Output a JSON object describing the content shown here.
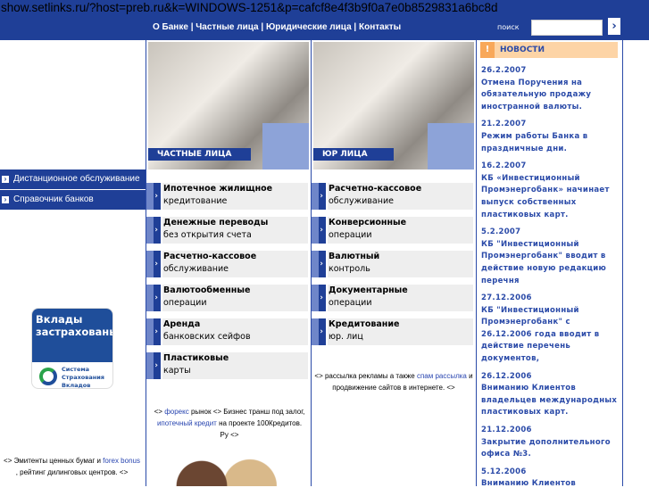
{
  "url": "show.setlinks.ru/?host=preb.ru&k=WINDOWS-1251&p=cafcf8e4f3b9f0a7e0b8529831a6bc8d",
  "nav": [
    "О Банке",
    "Частные лица",
    "Юридические лица",
    "Контакты"
  ],
  "search": {
    "label": "поиск",
    "value": "",
    "button": "›"
  },
  "photos": {
    "private": "ЧАСТНЫЕ ЛИЦА",
    "corporate": "ЮР ЛИЦА"
  },
  "left_menu": [
    "Дистанционное обслуживание",
    "Справочник банков"
  ],
  "badge": {
    "title": "Вклады застрахованы",
    "sub": "Система Страхования Вкладов"
  },
  "private_services": [
    {
      "bold": "Ипотечное жилищное",
      "rest": "кредитование"
    },
    {
      "bold": "Денежные переводы",
      "rest": "без открытия счета"
    },
    {
      "bold": "Расчетно-кассовое",
      "rest": "обслуживание"
    },
    {
      "bold": "Валютообменные",
      "rest": "операции"
    },
    {
      "bold": "Аренда",
      "rest": "банковских сейфов"
    },
    {
      "bold": "Пластиковые",
      "rest": "карты"
    }
  ],
  "corporate_services": [
    {
      "bold": "Расчетно-кассовое",
      "rest": "обслуживание"
    },
    {
      "bold": "Конверсионные",
      "rest": "операции"
    },
    {
      "bold": "Валютный",
      "rest": "контроль"
    },
    {
      "bold": "Документарные",
      "rest": "операции"
    },
    {
      "bold": "Кредитование",
      "rest": "юр. лиц"
    }
  ],
  "ads": {
    "left": {
      "t1": "<> Эмитенты ценных бумаг и ",
      "l1": "forex bonus",
      "t2": " , рейтинг дилинговых центров. <>"
    },
    "center": {
      "t1": "<> ",
      "l1": "форекс",
      "t2": " рынок <> Бизнес транш под залог, ",
      "l2": "ипотечный кредит",
      "t3": " на проекте 100Кредитов. Ру <>"
    },
    "right": {
      "t1": "<> рассылка рекламы а также ",
      "l1": "спам рассылка",
      "t2": " и продвижение сайтов в интернете. <>"
    }
  },
  "news": {
    "title": "НОВОСТИ",
    "items": [
      {
        "date": "26.2.2007",
        "text": "Отмена Поручения на обязательную продажу иностранной валюты."
      },
      {
        "date": "21.2.2007",
        "text": "Режим работы Банка в праздничные дни."
      },
      {
        "date": "16.2.2007",
        "text": "КБ «Инвестиционный Промэнергобанк» начинает выпуск собственных пластиковых карт."
      },
      {
        "date": "5.2.2007",
        "text": "КБ \"Инвестиционный Промэнергобанк\" вводит в действие новую редакцию перечня"
      },
      {
        "date": "27.12.2006",
        "text": "КБ \"Инвестиционный Промэнергобанк\" с 26.12.2006 года вводит в действие перечень документов,"
      },
      {
        "date": "26.12.2006",
        "text": "Вниманию Клиентов владельцев международных пластиковых карт."
      },
      {
        "date": "21.12.2006",
        "text": "Закрытие дополнительного офиса №3."
      },
      {
        "date": "5.12.2006",
        "text": "Вниманию Клиентов"
      }
    ]
  },
  "colors": {
    "primary": "#1f3f97",
    "news_head": "#fdd4a6",
    "link": "#2a4aa8"
  }
}
